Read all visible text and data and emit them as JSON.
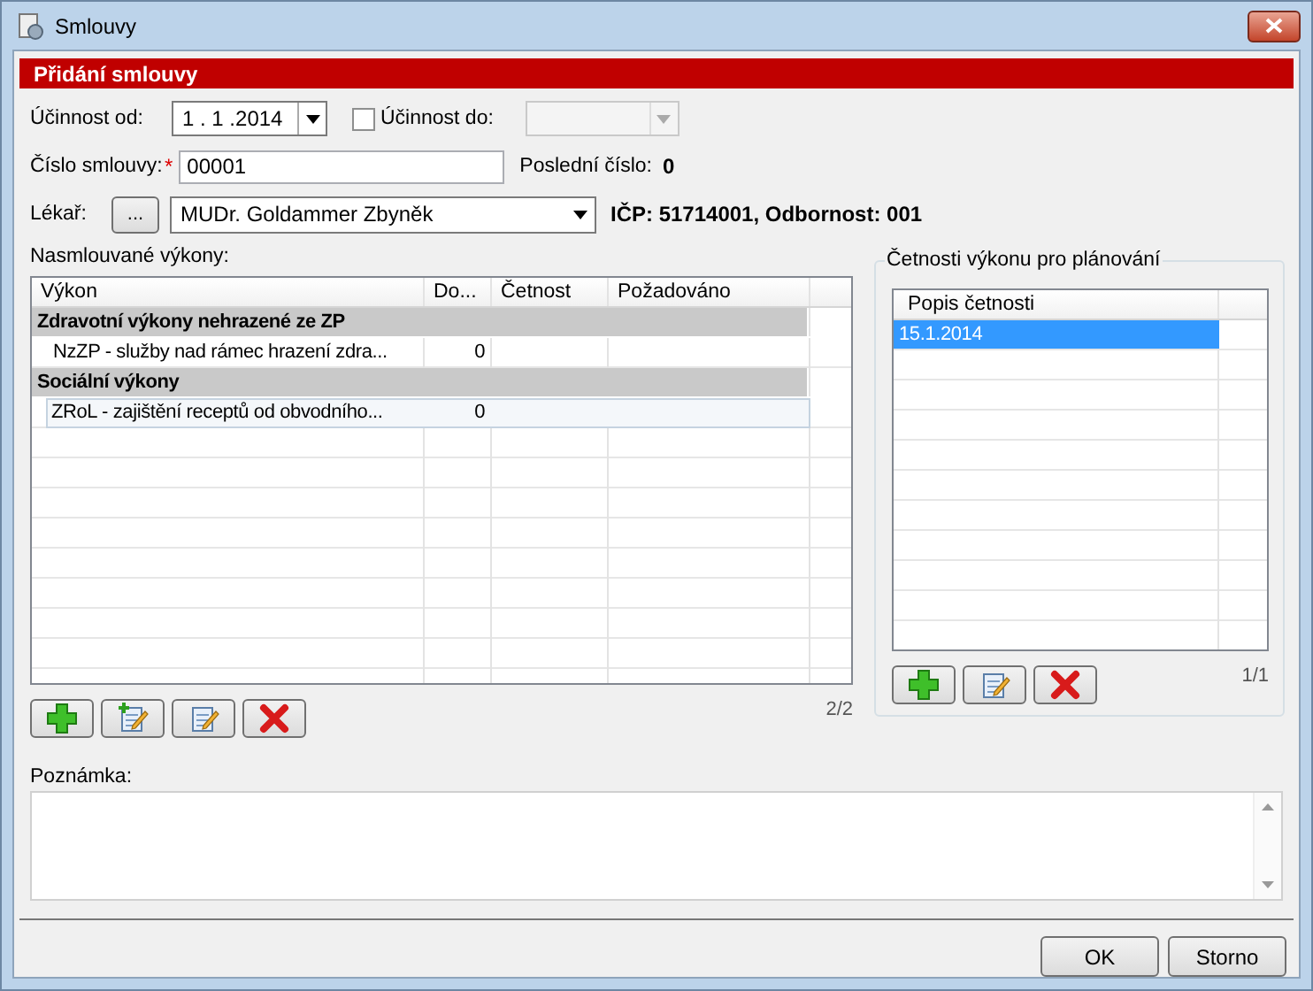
{
  "window": {
    "title": "Smlouvy"
  },
  "header": "Přidání smlouvy",
  "effective_from": {
    "label": "Účinnost od:",
    "value": "1 . 1 .2014"
  },
  "effective_to": {
    "label": "Účinnost do:",
    "checked": false,
    "disabled": true
  },
  "contract_number": {
    "label": "Číslo smlouvy:",
    "required_mark": "*",
    "value": "00001"
  },
  "last_number": {
    "label": "Poslední číslo:",
    "value": "0"
  },
  "doctor": {
    "label": "Lékař:",
    "browse": "...",
    "value": "MUDr. Goldammer Zbyněk",
    "info": "IČP: 51714001, Odbornost: 001"
  },
  "services": {
    "label": "Nasmlouvané výkony:",
    "columns": [
      "Výkon",
      "Do...",
      "Četnost",
      "Požadováno"
    ],
    "rows": [
      {
        "kind": "group",
        "selected": false,
        "cells": [
          "Zdravotní výkony nehrazené ze ZP"
        ]
      },
      {
        "kind": "item",
        "selected": false,
        "cells": [
          "NzZP - služby nad rámec hrazení zdra...",
          "0"
        ]
      },
      {
        "kind": "group",
        "selected": false,
        "cells": [
          "Sociální výkony"
        ]
      },
      {
        "kind": "item",
        "selected": true,
        "cells": [
          "ZRoL - zajištění receptů od obvodního...",
          "0"
        ]
      }
    ],
    "count": "2/2"
  },
  "frequency": {
    "legend": "Četnosti výkonu pro plánování",
    "columns": [
      "Popis četnosti"
    ],
    "rows": [
      {
        "selected": true,
        "cells": [
          "15.1.2014"
        ]
      }
    ],
    "count": "1/1"
  },
  "note": {
    "label": "Poznámka:"
  },
  "buttons": [
    "OK",
    "Storno"
  ]
}
